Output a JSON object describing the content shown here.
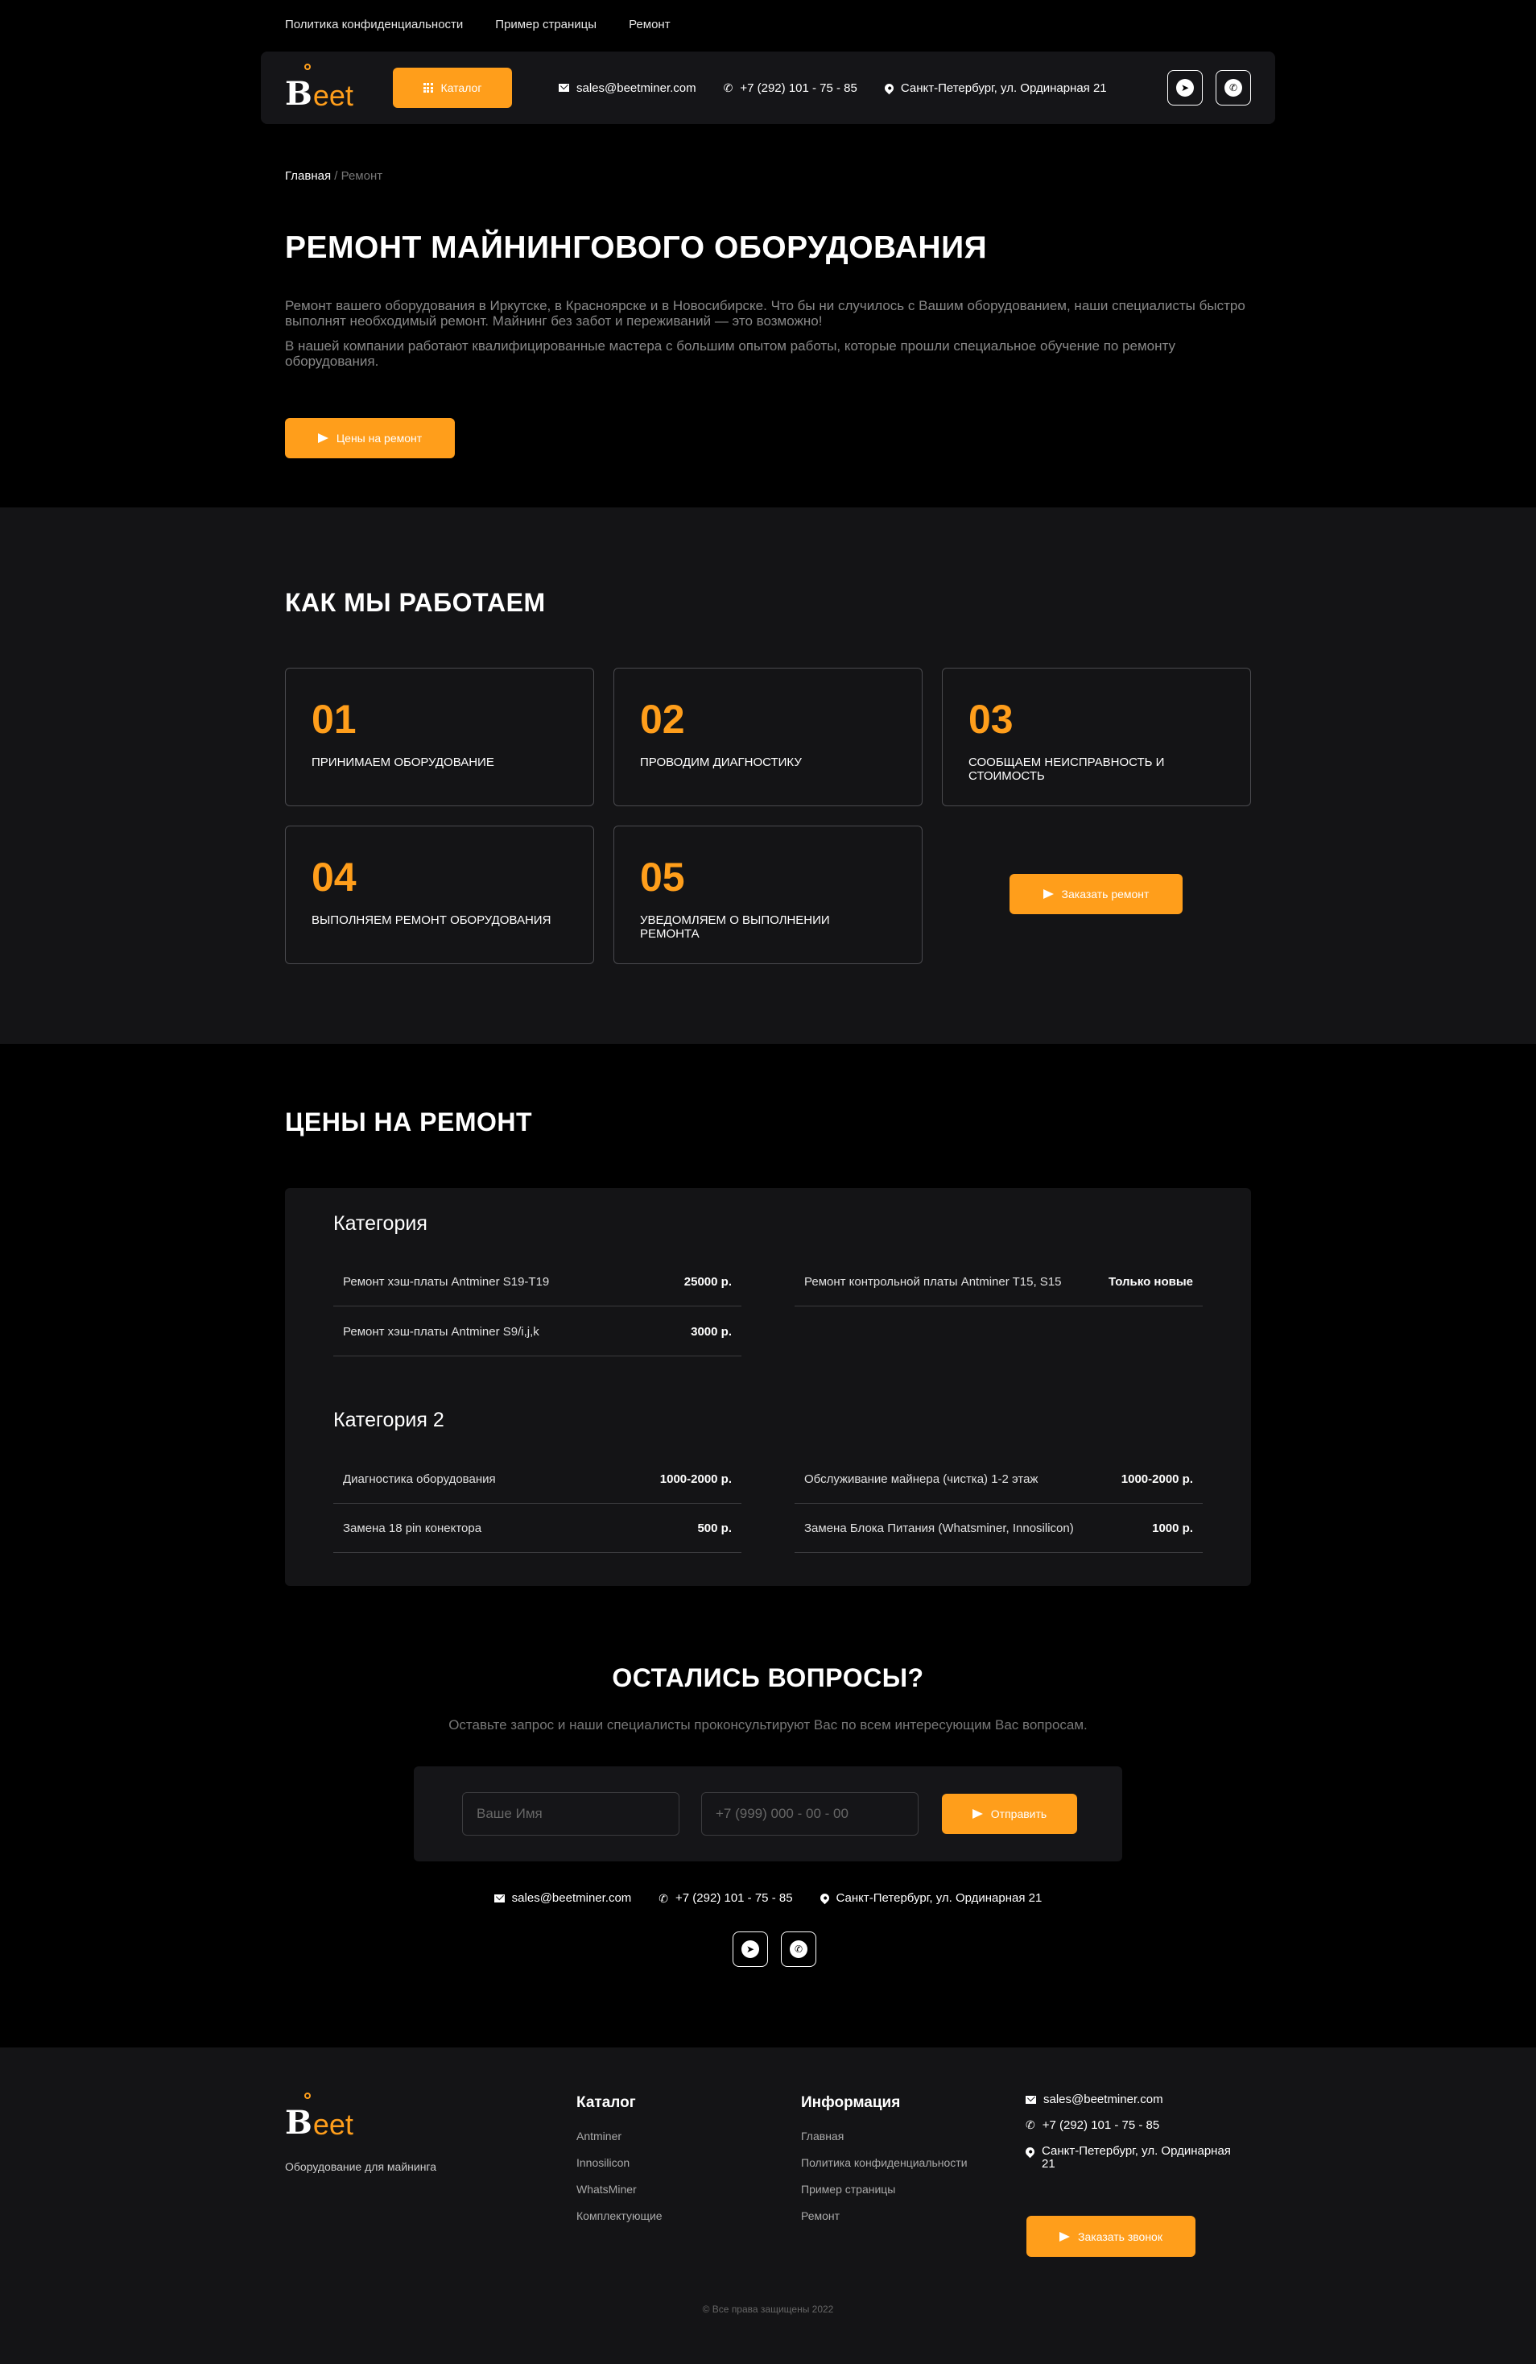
{
  "top_links": [
    "Политика конфиденциальности",
    "Пример страницы",
    "Ремонт"
  ],
  "header": {
    "logo_b": "B",
    "logo_text": "eet",
    "catalog_label": "Каталог",
    "email": "sales@beetminer.com",
    "phone": "+7 (292) 101 - 75 - 85",
    "address": "Санкт-Петербург, ул. Ординарная 21"
  },
  "breadcrumb": {
    "home": "Главная",
    "separator": " / ",
    "current": "Ремонт"
  },
  "hero": {
    "title": "РЕМОНТ МАЙНИНГОВОГО ОБОРУДОВАНИЯ",
    "paragraph1": "Ремонт вашего оборудования в Иркутске, в Красноярске и в Новосибирске. Что бы ни случилось с Вашим оборудованием, наши специалисты быстро выполнят необходимый ремонт. Майнинг без забот и переживаний — это возможно!",
    "paragraph2": "В нашей компании работают квалифицированные мастера с большим опытом работы, которые прошли специальное обучение по ремонту оборудования.",
    "button": "Цены на ремонт"
  },
  "work": {
    "title": "КАК МЫ РАБОТАЕМ",
    "steps": [
      {
        "num": "01",
        "label": "ПРИНИМАЕМ ОБОРУДОВАНИЕ"
      },
      {
        "num": "02",
        "label": "ПРОВОДИМ ДИАГНОСТИКУ"
      },
      {
        "num": "03",
        "label": "СООБЩАЕМ НЕИСПРАВНОСТЬ И СТОИМОСТЬ"
      },
      {
        "num": "04",
        "label": "ВЫПОЛНЯЕМ РЕМОНТ ОБОРУДОВАНИЯ"
      },
      {
        "num": "05",
        "label": "УВЕДОМЛЯЕМ О ВЫПОЛНЕНИИ РЕМОНТА"
      }
    ],
    "order_button": "Заказать ремонт"
  },
  "prices": {
    "title": "ЦЕНЫ НА РЕМОНТ",
    "categories": [
      {
        "name": "Категория",
        "rows": [
          {
            "name": "Ремонт хэш-платы Antminer S19-T19",
            "price": "25000 р."
          },
          {
            "name": "Ремонт контрольной платы Antminer T15, S15",
            "price": "Только новые"
          },
          {
            "name": "Ремонт хэш-платы Antminer S9/i,j,k",
            "price": "3000 р."
          }
        ]
      },
      {
        "name": "Категория 2",
        "rows": [
          {
            "name": "Диагностика оборудования",
            "price": "1000-2000 р."
          },
          {
            "name": "Обслуживание майнера (чистка) 1-2 этаж",
            "price": "1000-2000 р."
          },
          {
            "name": "Замена 18 pin конектора",
            "price": "500 р."
          },
          {
            "name": "Замена Блока Питания (Whatsminer, Innosilicon)",
            "price": "1000 р."
          }
        ]
      }
    ]
  },
  "questions": {
    "title": "ОСТАЛИСЬ ВОПРОСЫ?",
    "subtitle": "Оставьте запрос и наши специалисты проконсультируют Вас по всем интересующим Вас вопросам.",
    "name_placeholder": "Ваше Имя",
    "phone_placeholder": "+7 (999) 000 - 00 - 00",
    "send_button": "Отправить"
  },
  "footer": {
    "tagline": "Оборудование для майнинга",
    "catalog_title": "Каталог",
    "catalog_links": [
      "Antminer",
      "Innosilicon",
      "WhatsMiner",
      "Комплектующие"
    ],
    "info_title": "Информация",
    "info_links": [
      "Главная",
      "Политика конфиденциальности",
      "Пример страницы",
      "Ремонт"
    ],
    "call_button": "Заказать звонок",
    "copyright": "© Все права защищены 2022"
  },
  "colors": {
    "accent": "#ff9e1b",
    "background": "#000000",
    "panel": "#141416"
  },
  "icons": [
    "mail-icon",
    "phone-icon",
    "location-icon",
    "telegram-icon",
    "whatsapp-icon",
    "send-icon",
    "grid-icon"
  ]
}
